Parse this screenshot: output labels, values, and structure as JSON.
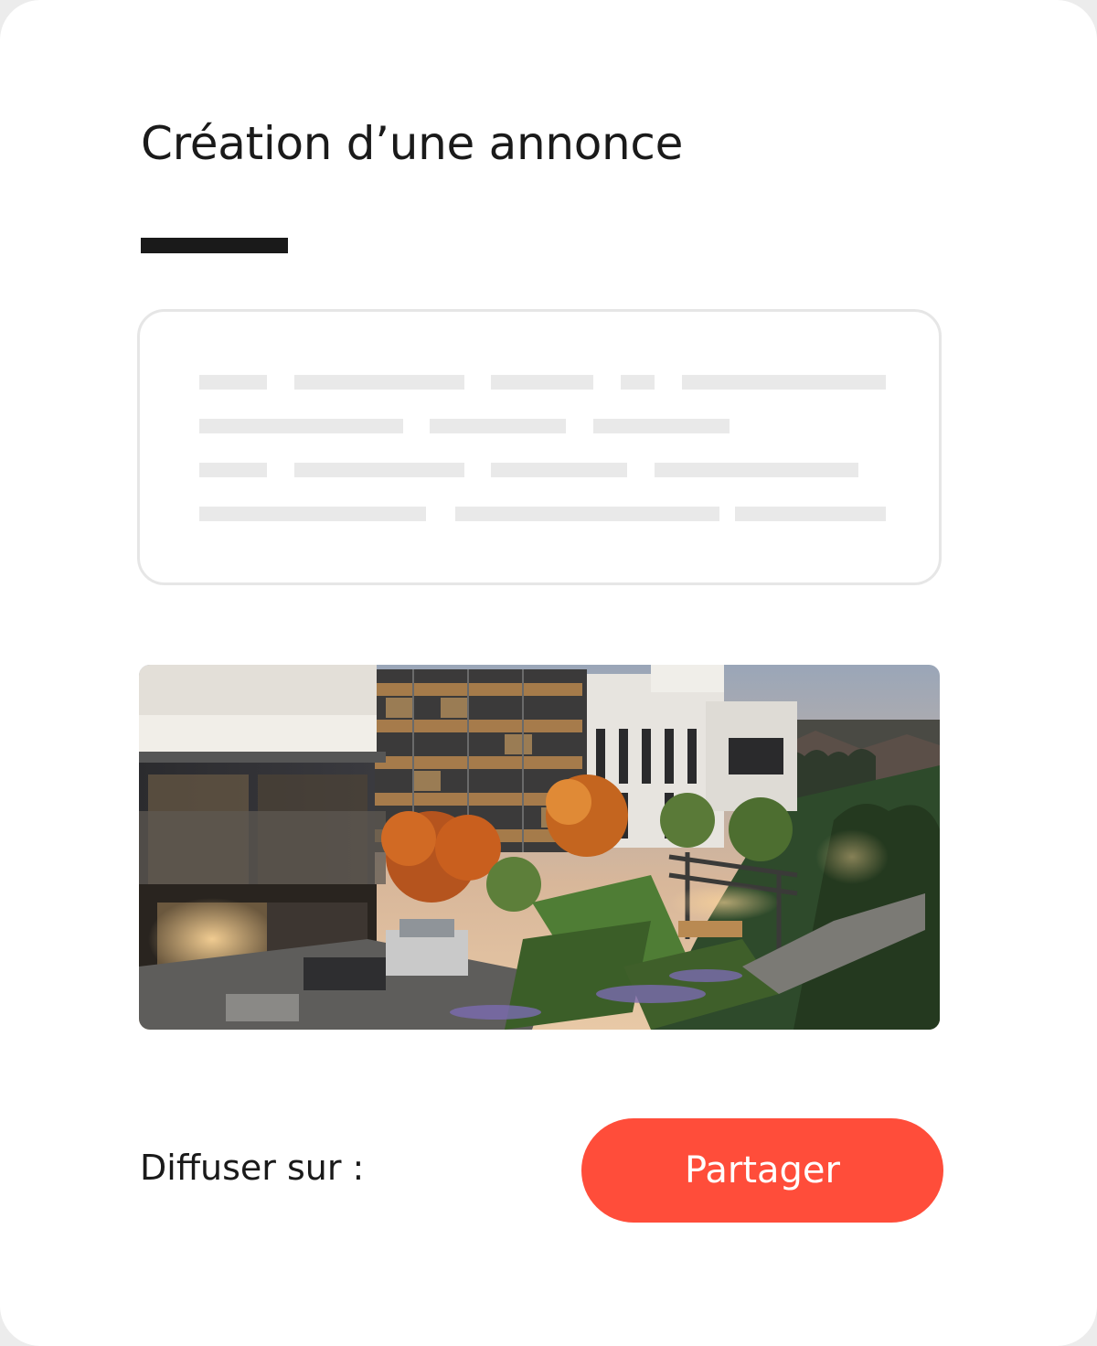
{
  "page": {
    "title": "Création d’une annonce"
  },
  "description_box": {
    "state": "placeholder"
  },
  "listing_photo": {
    "alt": ""
  },
  "footer": {
    "diffuse_label": "Diffuser sur :",
    "share_button_label": "Partager"
  },
  "colors": {
    "accent": "#ff4d3a",
    "text": "#1a1a1a",
    "placeholder_bar": "#e9e9e9",
    "box_border": "#e6e6e6"
  }
}
